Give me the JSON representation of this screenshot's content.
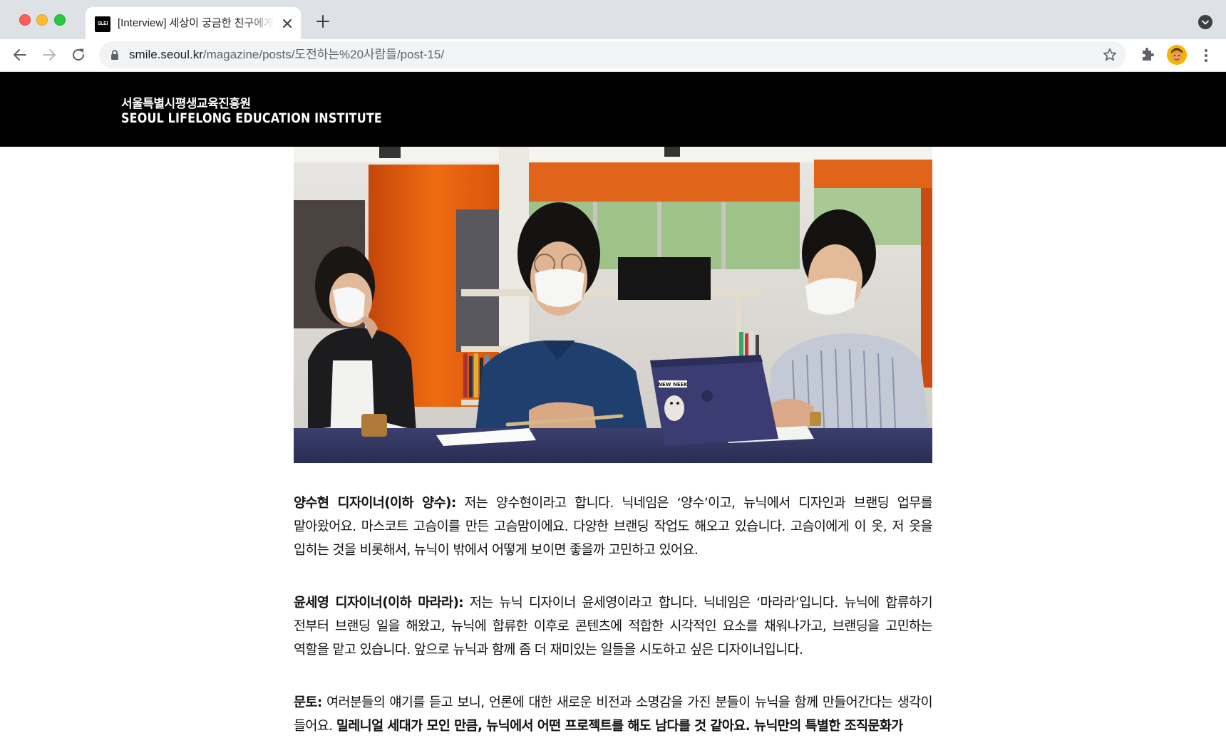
{
  "browser": {
    "tab": {
      "favicon_text": "SLEI",
      "title": "[Interview] 세상이 궁금한 친구에게"
    },
    "url": {
      "host": "smile.seoul.kr",
      "path": "/magazine/posts/도전하는%20사람들/post-15/"
    },
    "icons": [
      "back-icon",
      "forward-icon",
      "reload-icon",
      "lock-icon",
      "star-icon",
      "extensions-icon",
      "menu-icon"
    ]
  },
  "site": {
    "brand_ko": "서울특별시평생교육진흥원",
    "brand_en": "SEOUL LIFELONG EDUCATION INSTITUTE",
    "header_color": "#000000"
  },
  "photo": {
    "sticker_text": "NEW NEEK"
  },
  "article": {
    "paragraphs": [
      {
        "speaker": "양수현 디자이너(이하 양수):",
        "text": " 저는 양수현이라고 합니다. 닉네임은 ‘양수’이고, 뉴닉에서 디자인과 브랜딩 업무를 맡아왔어요. 마스코트 고슴이를 만든 고슴맘이에요. 다양한 브랜딩 작업도 해오고 있습니다. 고슴이에게 이 옷, 저 옷을 입히는 것을 비롯해서, 뉴닉이 밖에서 어떻게 보이면 좋을까 고민하고 있어요."
      },
      {
        "speaker": "윤세영 디자이너(이하 마라라):",
        "text": " 저는 뉴닉 디자이너 윤세영이라고 합니다. 닉네임은 ‘마라라’입니다. 뉴닉에 합류하기 전부터 브랜딩 일을 해왔고, 뉴닉에 합류한 이후로 콘텐츠에 적합한 시각적인 요소를 채워나가고, 브랜딩을 고민하는 역할을 맡고 있습니다. 앞으로 뉴닉과 함께 좀 더 재미있는 일들을 시도하고 싶은 디자이너입니다."
      },
      {
        "speaker": "문토:",
        "text": " 여러분들의 얘기를 듣고 보니, 언론에 대한 새로운 비전과 소명감을 가진 분들이 뉴닉을 함께 만들어간다는 생각이 들어요. ",
        "emphasis": "밀레니얼 세대가 모인 만큼, 뉴닉에서 어떤 프로젝트를 해도 남다를 것 같아요. 뉴닉만의 특별한 조직문화가"
      }
    ]
  }
}
